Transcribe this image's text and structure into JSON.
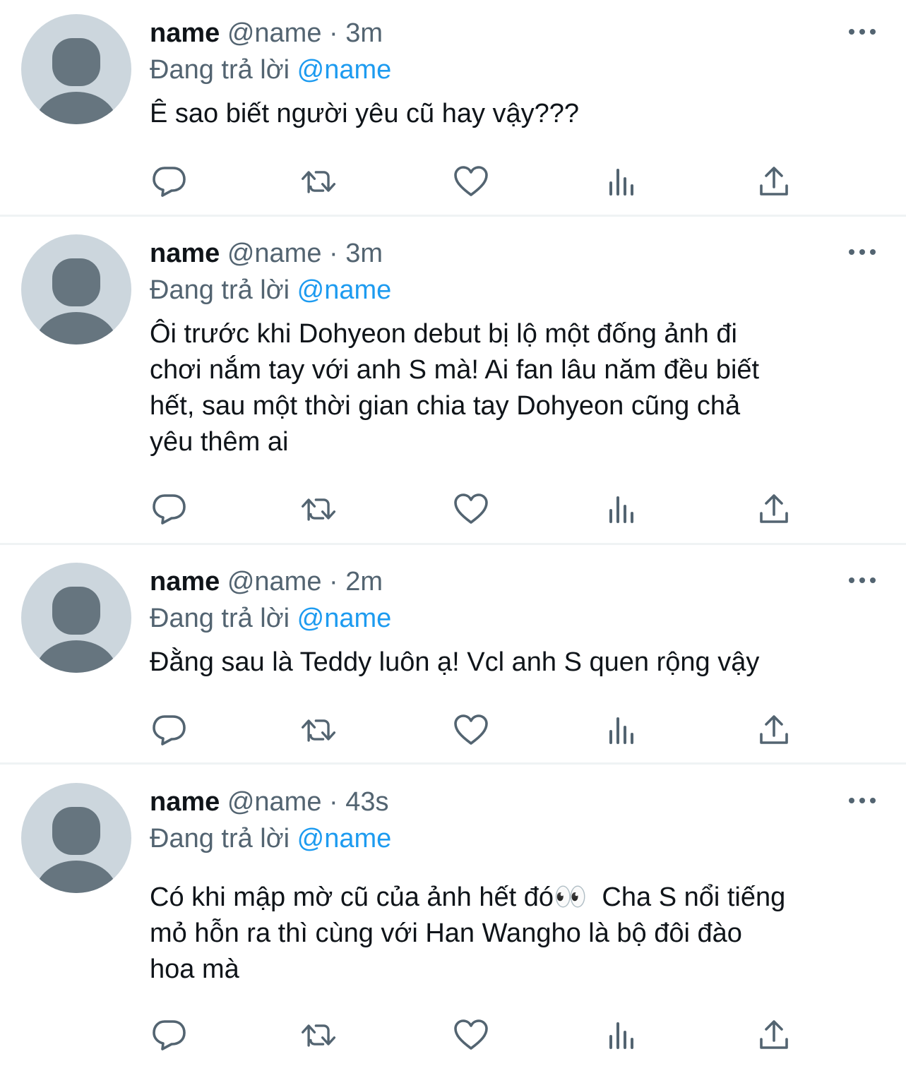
{
  "tweets": [
    {
      "name": "name",
      "handle": "@name",
      "separator": "·",
      "time": "3m",
      "reply_prefix": "Đang trả lời",
      "reply_to": "@name",
      "text": "Ê sao biết người yêu cũ hay vậy???"
    },
    {
      "name": "name",
      "handle": "@name",
      "separator": "·",
      "time": "3m",
      "reply_prefix": "Đang trả lời",
      "reply_to": "@name",
      "text": "Ôi trước khi Dohyeon debut bị lộ một đống ảnh đi\nchơi nắm tay với anh S mà! Ai fan lâu năm đều biết\nhết, sau một thời gian chia tay Dohyeon cũng chả\nyêu thêm ai"
    },
    {
      "name": "name",
      "handle": "@name",
      "separator": "·",
      "time": "2m",
      "reply_prefix": "Đang trả lời",
      "reply_to": "@name",
      "text": "Đằng sau là Teddy luôn ạ! Vcl anh S quen rộng vậy"
    },
    {
      "name": "name",
      "handle": "@name",
      "separator": "·",
      "time": "43s",
      "reply_prefix": "Đang trả lời",
      "reply_to": "@name",
      "text": "Có khi mập mờ cũ của ảnh hết đó👀  Cha S nổi tiếng\nmỏ hỗn ra thì cùng với Han Wangho là bộ đôi đào\nhoa mà"
    }
  ],
  "icons": {
    "reply": "reply-icon",
    "retweet": "retweet-icon",
    "like": "heart-icon",
    "views": "views-icon",
    "share": "share-icon",
    "more": "more-icon",
    "avatar": "default-avatar-icon"
  },
  "colors": {
    "text": "#0f1419",
    "secondary": "#536471",
    "link": "#1d9bf0",
    "avatar_bg": "#ccd6dd",
    "avatar_fg": "#66757f",
    "divider": "#eff3f4"
  }
}
